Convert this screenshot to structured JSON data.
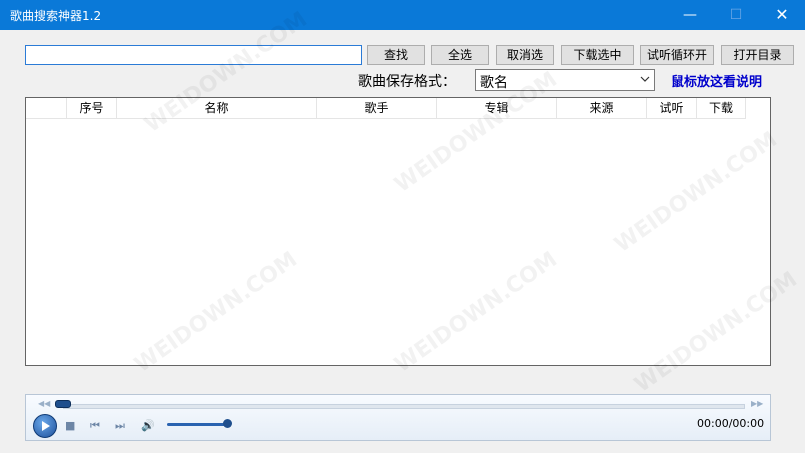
{
  "window": {
    "title": "歌曲搜索神器1.2",
    "min_icon": "—",
    "max_icon": "☐",
    "close_icon": "✕"
  },
  "search": {
    "value": "",
    "placeholder": ""
  },
  "toolbar": {
    "search_label": "查找",
    "select_all_label": "全选",
    "deselect_label": "取消选",
    "download_selected_label": "下载选中",
    "loop_preview_label": "试听循环开",
    "open_dir_label": "打开目录"
  },
  "format": {
    "label": "歌曲保存格式：",
    "selected": "歌名"
  },
  "help_link": "鼠标放这看说明",
  "table": {
    "columns": [
      "",
      "序号",
      "名称",
      "歌手",
      "专辑",
      "来源",
      "试听",
      "下载"
    ],
    "rows": []
  },
  "player": {
    "time": "00:00/00:00",
    "progress": 0
  },
  "watermark": "WEIDOWN.COM"
}
